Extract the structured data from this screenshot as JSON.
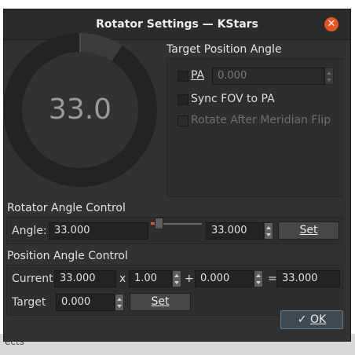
{
  "window": {
    "title": "Rotator Settings — KStars"
  },
  "background_text": "ects",
  "gauge": {
    "value": "33.0",
    "fraction": 0.0917
  },
  "target_pa": {
    "title": "Target Position Angle",
    "pa_label": "PA",
    "pa_value": "0.000",
    "sync_label": "Sync FOV to PA",
    "meridian_label": "Rotate After Meridian Flip"
  },
  "rotator": {
    "title": "Rotator Angle Control",
    "angle_label": "Angle:",
    "angle_value": "33.000",
    "spin_value": "33.000",
    "set_label": "Set",
    "slider_fraction": 0.0917
  },
  "position": {
    "title": "Position Angle Control",
    "current_label": "Current",
    "current_value": "33.000",
    "times_sign": "x",
    "multiplier": "1.00",
    "plus_sign": "+",
    "offset": "0.000",
    "equals_sign": "=",
    "result": "33.000",
    "target_label": "Target",
    "target_value": "0.000",
    "set_label": "Set"
  },
  "footer": {
    "ok_label": "OK",
    "ok_icon": "checkmark-icon"
  }
}
